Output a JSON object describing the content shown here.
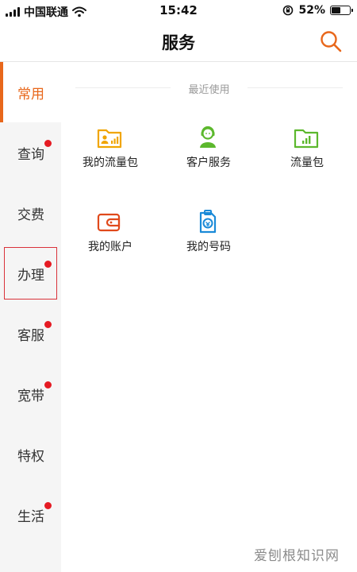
{
  "status_bar": {
    "carrier": "中国联通",
    "time": "15:42",
    "battery_percent": "52%",
    "battery_level": 0.52
  },
  "header": {
    "title": "服务"
  },
  "sidebar": {
    "items": [
      {
        "label": "常用",
        "badge": false
      },
      {
        "label": "查询",
        "badge": true
      },
      {
        "label": "交费",
        "badge": false
      },
      {
        "label": "办理",
        "badge": true
      },
      {
        "label": "客服",
        "badge": true
      },
      {
        "label": "宽带",
        "badge": true
      },
      {
        "label": "特权",
        "badge": false
      },
      {
        "label": "生活",
        "badge": true
      }
    ]
  },
  "main": {
    "section_title": "最近使用",
    "tiles": [
      {
        "label": "我的流量包",
        "icon": "data-package-icon"
      },
      {
        "label": "客户服务",
        "icon": "customer-service-icon"
      },
      {
        "label": "流量包",
        "icon": "traffic-package-icon"
      },
      {
        "label": "我的账户",
        "icon": "wallet-icon"
      },
      {
        "label": "我的号码",
        "icon": "sim-card-icon"
      }
    ]
  },
  "colors": {
    "accent": "#e8671b",
    "badge": "#e51b23",
    "yellow": "#f0a500",
    "green": "#5cb82d",
    "blue": "#1a8ad8",
    "red_orange": "#e0491b"
  },
  "watermark": "爱刨根知识网"
}
